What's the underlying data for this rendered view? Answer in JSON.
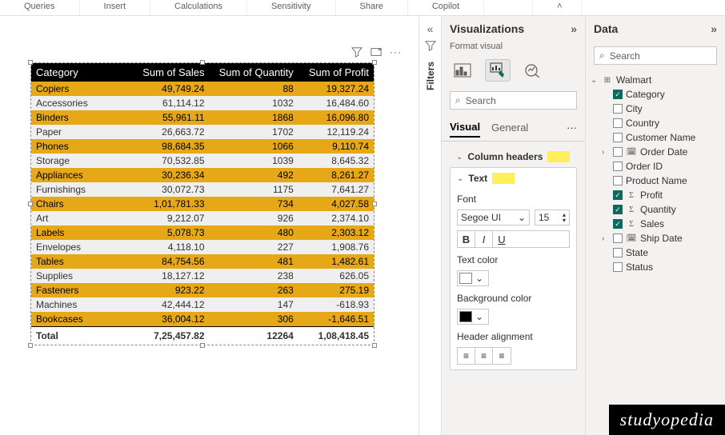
{
  "ribbon": {
    "tabs": [
      "Queries",
      "Insert",
      "Calculations",
      "Sensitivity",
      "Share",
      "Copilot"
    ]
  },
  "panes": {
    "filters": "Filters",
    "viz": {
      "title": "Visualizations",
      "subtitle": "Format visual"
    },
    "data": {
      "title": "Data"
    }
  },
  "search": {
    "placeholder": "Search"
  },
  "viz_tabs": {
    "visual": "Visual",
    "general": "General"
  },
  "format": {
    "column_headers": {
      "label": "Column headers",
      "text_section": {
        "label": "Text",
        "font_label": "Font",
        "font_name": "Segoe UI",
        "font_size": "15",
        "text_color_label": "Text color",
        "text_color": "#ffffff",
        "bg_label": "Background color",
        "bg_color": "#000000",
        "align_label": "Header alignment"
      }
    }
  },
  "dataset": {
    "table": "Walmart",
    "fields": [
      {
        "name": "Category",
        "checked": true,
        "expandable": false,
        "agg": false
      },
      {
        "name": "City",
        "checked": false,
        "expandable": false,
        "agg": false
      },
      {
        "name": "Country",
        "checked": false,
        "expandable": false,
        "agg": false
      },
      {
        "name": "Customer Name",
        "checked": false,
        "expandable": false,
        "agg": false
      },
      {
        "name": "Order Date",
        "checked": false,
        "expandable": true,
        "agg": false,
        "calendar": true
      },
      {
        "name": "Order ID",
        "checked": false,
        "expandable": false,
        "agg": false
      },
      {
        "name": "Product Name",
        "checked": false,
        "expandable": false,
        "agg": false
      },
      {
        "name": "Profit",
        "checked": true,
        "expandable": false,
        "agg": true
      },
      {
        "name": "Quantity",
        "checked": true,
        "expandable": false,
        "agg": true
      },
      {
        "name": "Sales",
        "checked": true,
        "expandable": false,
        "agg": true
      },
      {
        "name": "Ship Date",
        "checked": false,
        "expandable": true,
        "agg": false,
        "calendar": true
      },
      {
        "name": "State",
        "checked": false,
        "expandable": false,
        "agg": false
      },
      {
        "name": "Status",
        "checked": false,
        "expandable": false,
        "agg": false
      }
    ]
  },
  "chart_data": {
    "type": "table",
    "columns": [
      "Category",
      "Sum of Sales",
      "Sum of Quantity",
      "Sum of Profit"
    ],
    "rows": [
      [
        "Copiers",
        "49,749.24",
        "88",
        "19,327.24"
      ],
      [
        "Accessories",
        "61,114.12",
        "1032",
        "16,484.60"
      ],
      [
        "Binders",
        "55,961.11",
        "1868",
        "16,096.80"
      ],
      [
        "Paper",
        "26,663.72",
        "1702",
        "12,119.24"
      ],
      [
        "Phones",
        "98,684.35",
        "1066",
        "9,110.74"
      ],
      [
        "Storage",
        "70,532.85",
        "1039",
        "8,645.32"
      ],
      [
        "Appliances",
        "30,236.34",
        "492",
        "8,261.27"
      ],
      [
        "Furnishings",
        "30,072.73",
        "1175",
        "7,641.27"
      ],
      [
        "Chairs",
        "1,01,781.33",
        "734",
        "4,027.58"
      ],
      [
        "Art",
        "9,212.07",
        "926",
        "2,374.10"
      ],
      [
        "Labels",
        "5,078.73",
        "480",
        "2,303.12"
      ],
      [
        "Envelopes",
        "4,118.10",
        "227",
        "1,908.76"
      ],
      [
        "Tables",
        "84,754.56",
        "481",
        "1,482.61"
      ],
      [
        "Supplies",
        "18,127.12",
        "238",
        "626.05"
      ],
      [
        "Fasteners",
        "923.22",
        "263",
        "275.19"
      ],
      [
        "Machines",
        "42,444.12",
        "147",
        "-618.93"
      ],
      [
        "Bookcases",
        "36,004.12",
        "306",
        "-1,646.51"
      ]
    ],
    "totals": [
      "Total",
      "7,25,457.82",
      "12264",
      "1,08,418.45"
    ]
  },
  "brand": "studyopedia"
}
